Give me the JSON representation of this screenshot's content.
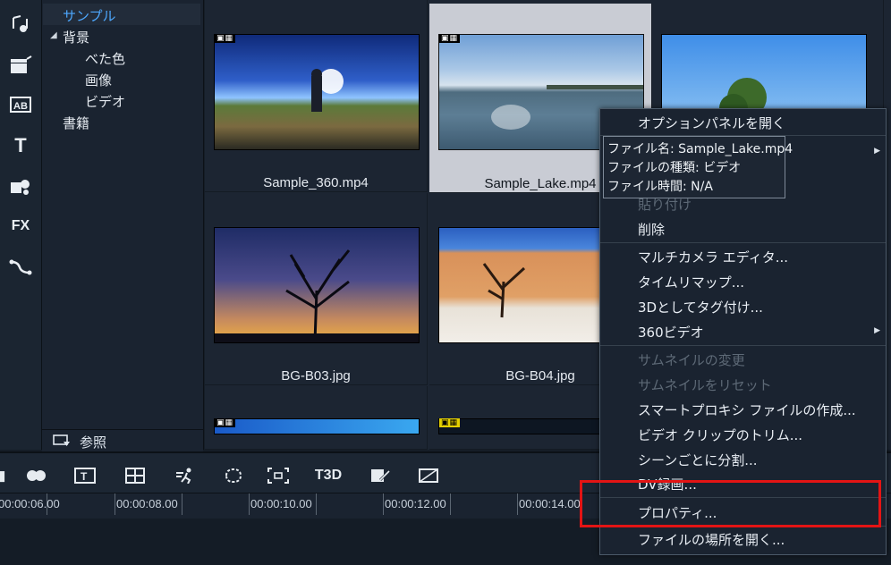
{
  "rail": {
    "icons": [
      "music-note-icon",
      "clapper-icon",
      "title-ab-icon",
      "text-t-icon",
      "puzzle-icon",
      "fx-icon",
      "path-icon"
    ],
    "fx_label": "FX"
  },
  "tree": {
    "selected": "サンプル",
    "expand_glyph": "◢",
    "items": [
      {
        "label": "サンプル"
      },
      {
        "label": "背景"
      },
      {
        "label": "べた色"
      },
      {
        "label": "画像"
      },
      {
        "label": "ビデオ"
      },
      {
        "label": "書籍"
      }
    ],
    "browse_label": "参照"
  },
  "grid": {
    "items": [
      {
        "caption": "Sample_360.mp4",
        "tag": "▣▦",
        "selected": false
      },
      {
        "caption": "Sample_Lake.mp4",
        "tag": "▣▦",
        "selected": true
      },
      {
        "caption": "",
        "tag": "",
        "selected": false
      },
      {
        "caption": "BG-B03.jpg",
        "tag": "",
        "selected": false
      },
      {
        "caption": "BG-B04.jpg",
        "tag": "",
        "selected": false
      },
      {
        "caption": "",
        "tag": "▣▦",
        "selected": false
      },
      {
        "caption": "",
        "tag": "▣▦",
        "selected": false
      }
    ]
  },
  "menu": {
    "items": [
      {
        "label": "オプションパネルを開く",
        "disabled": false
      },
      {
        "label": "貼り付け",
        "disabled": true
      },
      {
        "label": "削除",
        "disabled": false
      },
      {
        "label": "マルチカメラ エディタ...",
        "disabled": false
      },
      {
        "label": "タイムリマップ...",
        "disabled": false
      },
      {
        "label": "3Dとしてタグ付け...",
        "disabled": false
      },
      {
        "label": "360ビデオ",
        "disabled": false
      },
      {
        "label": "サムネイルの変更",
        "disabled": true
      },
      {
        "label": "サムネイルをリセット",
        "disabled": true
      },
      {
        "label": "スマートプロキシ ファイルの作成...",
        "disabled": false
      },
      {
        "label": "ビデオ クリップのトリム...",
        "disabled": false
      },
      {
        "label": "シーンごとに分割...",
        "disabled": false
      },
      {
        "label": "DV録画...",
        "disabled": false
      },
      {
        "label": "プロパティ...",
        "disabled": false
      },
      {
        "label": "ファイルの場所を開く...",
        "disabled": false
      }
    ],
    "submenu_arrow": "▶"
  },
  "tooltip": {
    "lines": [
      "ファイル名: Sample_Lake.mp4",
      "ファイルの種類: ビデオ",
      "ファイル時間: N/A"
    ]
  },
  "timeline": {
    "tools": [
      "trim-icon",
      "split-icon",
      "title-icon",
      "grid-icon",
      "motion-icon",
      "mask-icon",
      "track-icon",
      "3d-title-icon",
      "edit-icon",
      "crop-icon"
    ],
    "tool_3d_label": "T3D",
    "ticks": [
      "00:00:06.00",
      "00:00:08.00",
      "00:00:10.00",
      "00:00:12.00",
      "00:00:14.00"
    ]
  },
  "colors": {
    "accent": "#4da8ff",
    "highlight": "#e31414"
  }
}
